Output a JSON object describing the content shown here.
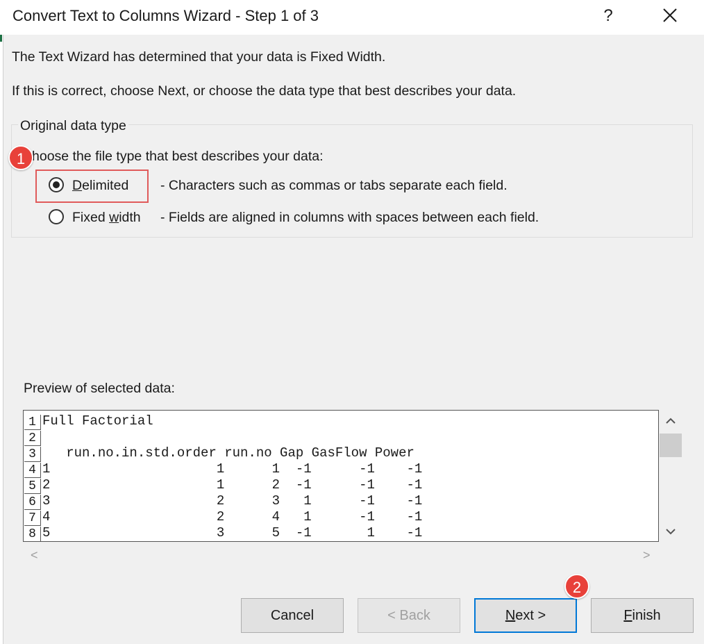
{
  "window": {
    "title": "Convert Text to Columns Wizard - Step 1 of 3",
    "help_label": "?",
    "close_icon": "close-icon"
  },
  "intro": {
    "line1": "The Text Wizard has determined that your data is Fixed Width.",
    "line2": "If this is correct, choose Next, or choose the data type that best describes your data."
  },
  "group": {
    "legend": "Original data type",
    "prompt": "hoose the file type that best describes your data:",
    "options": [
      {
        "label_pre": "",
        "label_u": "D",
        "label_post": "elimited",
        "desc": "- Characters such as commas or tabs separate each field.",
        "selected": true
      },
      {
        "label_pre": "Fixed ",
        "label_u": "w",
        "label_post": "idth",
        "desc": "- Fields are aligned in columns with spaces between each field.",
        "selected": false
      }
    ]
  },
  "annotations": {
    "badge1": "1",
    "badge2": "2",
    "accent": "#e8413a"
  },
  "preview": {
    "label": "Preview of selected data:",
    "lines": [
      {
        "num": "1",
        "text": "Full Factorial"
      },
      {
        "num": "2",
        "text": ""
      },
      {
        "num": "3",
        "text": "   run.no.in.std.order run.no Gap GasFlow Power"
      },
      {
        "num": "4",
        "text": "1                     1      1  -1      -1    -1"
      },
      {
        "num": "5",
        "text": "2                     1      2  -1      -1    -1"
      },
      {
        "num": "6",
        "text": "3                     2      3   1      -1    -1"
      },
      {
        "num": "7",
        "text": "4                     2      4   1      -1    -1"
      },
      {
        "num": "8",
        "text": "5                     3      5  -1       1    -1"
      }
    ],
    "scroll_up": "⌃",
    "scroll_down": "⌄",
    "scroll_left": "<",
    "scroll_right": ">"
  },
  "buttons": {
    "cancel": "Cancel",
    "back": "< Back",
    "next_u": "N",
    "next_rest": "ext >",
    "finish_u": "F",
    "finish_rest": "inish"
  }
}
